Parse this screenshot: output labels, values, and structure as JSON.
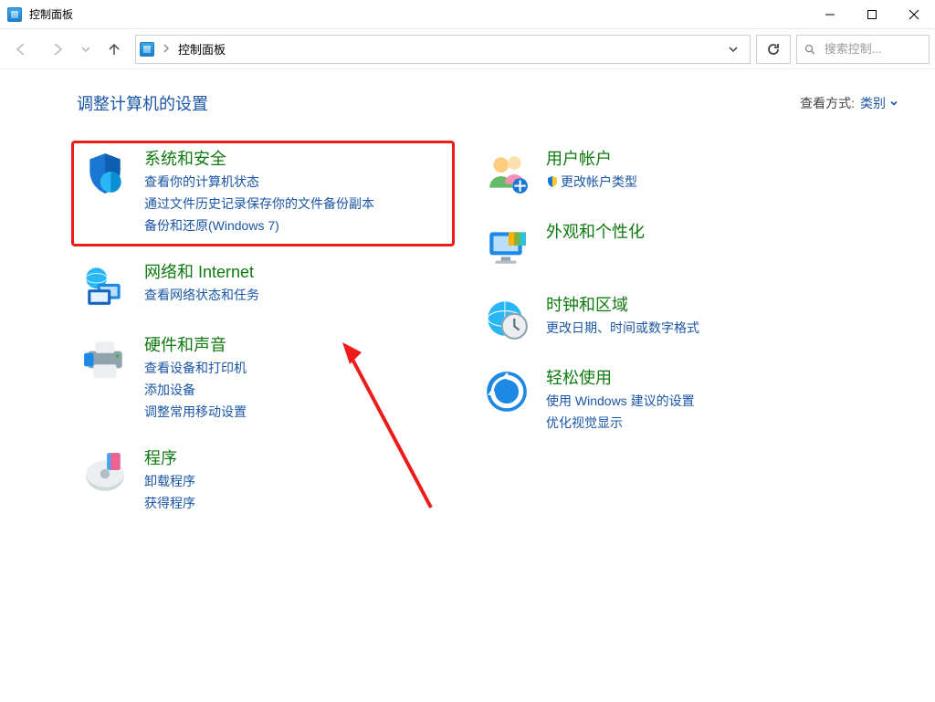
{
  "window": {
    "title": "控制面板"
  },
  "toolbar": {
    "breadcrumb": "控制面板",
    "search_placeholder": "搜索控制..."
  },
  "header": {
    "heading": "调整计算机的设置",
    "viewby_label": "查看方式:",
    "viewby_value": "类别"
  },
  "left": {
    "system": {
      "title": "系统和安全",
      "links": {
        "status": "查看你的计算机状态",
        "history": "通过文件历史记录保存你的文件备份副本",
        "backup": "备份和还原(Windows 7)"
      }
    },
    "network": {
      "title": "网络和 Internet",
      "links": {
        "status": "查看网络状态和任务"
      }
    },
    "hardware": {
      "title": "硬件和声音",
      "links": {
        "devices": "查看设备和打印机",
        "add": "添加设备",
        "mobility": "调整常用移动设置"
      }
    },
    "programs": {
      "title": "程序",
      "links": {
        "uninstall": "卸载程序",
        "get": "获得程序"
      }
    }
  },
  "right": {
    "accounts": {
      "title": "用户帐户",
      "links": {
        "change": "更改帐户类型"
      }
    },
    "appearance": {
      "title": "外观和个性化"
    },
    "clock": {
      "title": "时钟和区域",
      "links": {
        "datetime": "更改日期、时间或数字格式"
      }
    },
    "ease": {
      "title": "轻松使用",
      "links": {
        "settings": "使用 Windows 建议的设置",
        "visual": "优化视觉显示"
      }
    }
  }
}
